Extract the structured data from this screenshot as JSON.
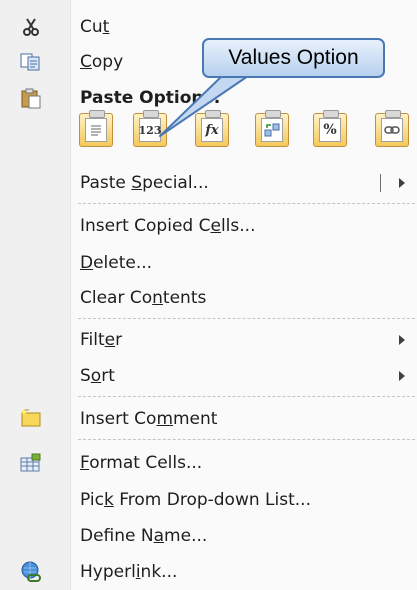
{
  "menu": {
    "cut": {
      "pre": "Cu",
      "u": "t",
      "post": ""
    },
    "copy": {
      "pre": "",
      "u": "C",
      "post": "opy"
    },
    "paste_options_label": "Paste Options:",
    "paste_buttons": [
      "paste-icon",
      "values-icon",
      "formulas-icon",
      "transpose-icon",
      "formatting-icon",
      "paste-link-icon"
    ],
    "paste_button_glyphs": [
      "",
      "123",
      "fx",
      "",
      "%",
      ""
    ],
    "paste_special": {
      "pre": "Paste ",
      "u": "S",
      "post": "pecial..."
    },
    "insert_copied_cells": {
      "pre": "Insert Copied C",
      "u": "e",
      "post": "lls..."
    },
    "delete": {
      "pre": "",
      "u": "D",
      "post": "elete..."
    },
    "clear_contents": {
      "pre": "Clear Co",
      "u": "n",
      "post": "tents"
    },
    "filter": {
      "pre": "Filt",
      "u": "e",
      "post": "r"
    },
    "sort": {
      "pre": "S",
      "u": "o",
      "post": "rt"
    },
    "insert_comment": {
      "pre": "Insert Co",
      "u": "m",
      "post": "ment"
    },
    "format_cells": {
      "pre": "",
      "u": "F",
      "post": "ormat Cells..."
    },
    "pick_list": {
      "pre": "Pic",
      "u": "k",
      "post": " From Drop-down List..."
    },
    "define_name": {
      "pre": "Define N",
      "u": "a",
      "post": "me..."
    },
    "hyperlink": {
      "pre": "Hyperl",
      "u": "i",
      "post": "nk..."
    }
  },
  "callout": {
    "text": "Values Option"
  }
}
